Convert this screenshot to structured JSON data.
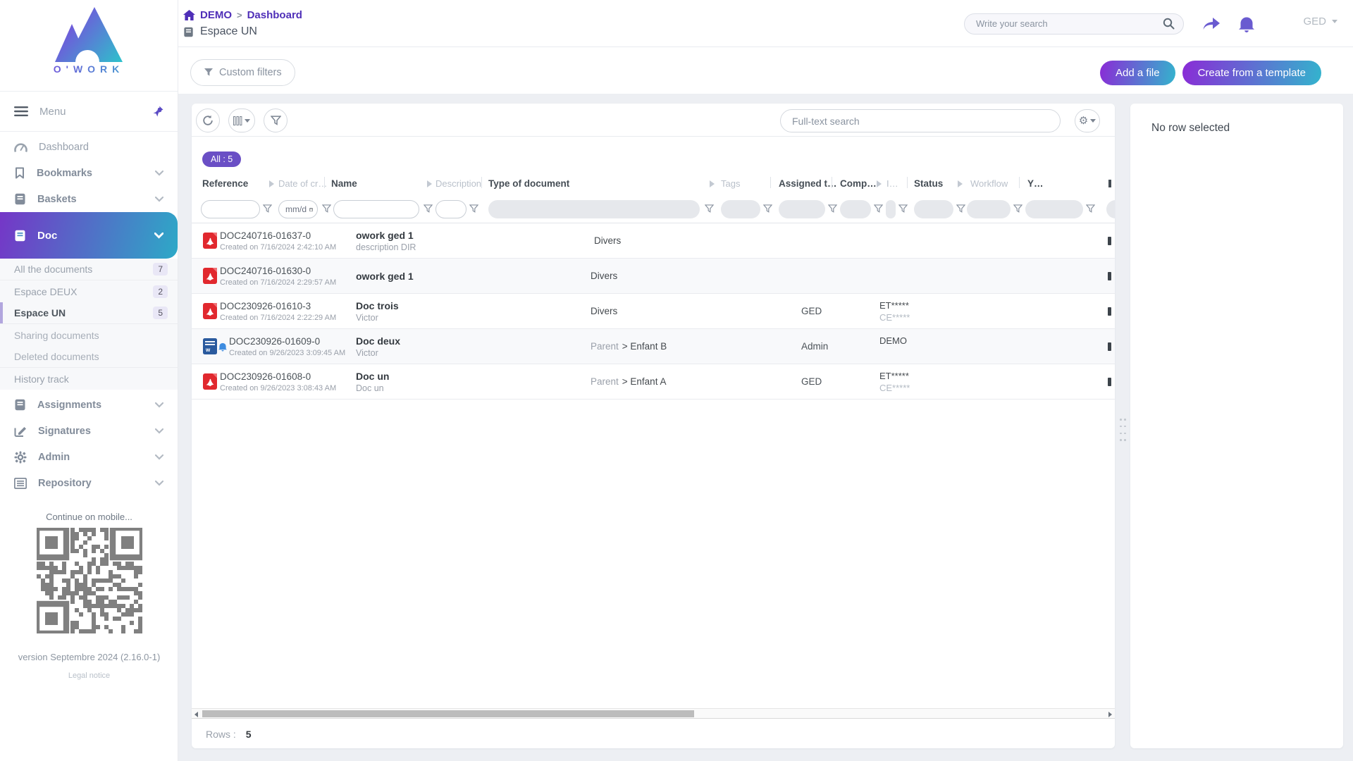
{
  "brand": {
    "name": "O'WORK"
  },
  "header": {
    "breadcrumb": {
      "root": "DEMO",
      "sep": ">",
      "current": "Dashboard"
    },
    "space_title": "Espace UN",
    "search_placeholder": "Write your search",
    "user_menu": "GED",
    "custom_filters": "Custom filters",
    "add_file": "Add a file",
    "create_template": "Create from a template"
  },
  "sidebar": {
    "menu_label": "Menu",
    "dashboard": "Dashboard",
    "bookmarks": "Bookmarks",
    "baskets": "Baskets",
    "doc": "Doc",
    "doc_submenu": [
      {
        "label": "All the documents",
        "badge": "7"
      },
      {
        "label": "Espace DEUX",
        "badge": "2"
      },
      {
        "label": "Espace UN",
        "badge": "5"
      },
      {
        "label": "Sharing documents",
        "badge": ""
      },
      {
        "label": "Deleted documents",
        "badge": ""
      },
      {
        "label": "History track",
        "badge": ""
      }
    ],
    "assignments": "Assignments",
    "signatures": "Signatures",
    "admin": "Admin",
    "repository": "Repository",
    "mobile_hint": "Continue on mobile...",
    "version": "version Septembre 2024 (2.16.0-1)",
    "legal": "Legal notice"
  },
  "toolbar": {
    "fulltext_placeholder": "Full-text search",
    "tab_all": "All : 5"
  },
  "table": {
    "columns": [
      {
        "label": "Reference"
      },
      {
        "label": "Date of cr…"
      },
      {
        "label": "Name"
      },
      {
        "label": "Description"
      },
      {
        "label": "Type of document"
      },
      {
        "label": "Tags"
      },
      {
        "label": "Assigned t…"
      },
      {
        "label": "Comp…"
      },
      {
        "label": "I…"
      },
      {
        "label": "Status"
      },
      {
        "label": "Workflow"
      },
      {
        "label": "Y…"
      }
    ],
    "date_filter_placeholder": "mm/d",
    "rows": [
      {
        "ref": "DOC240716-01637-0",
        "created": "Created on 7/16/2024 2:42:10 AM",
        "name": "owork ged 1",
        "name_sub": "description DIR",
        "type_parent": "",
        "type_name": "Divers",
        "assigned": "",
        "comp_top": "",
        "comp_sub": ""
      },
      {
        "ref": "DOC240716-01630-0",
        "created": "Created on 7/16/2024 2:29:57 AM",
        "name": "owork ged 1",
        "name_sub": "",
        "type_parent": "",
        "type_name": "Divers",
        "assigned": "",
        "comp_top": "",
        "comp_sub": ""
      },
      {
        "ref": "DOC230926-01610-3",
        "created": "Created on 7/16/2024 2:22:29 AM",
        "name": "Doc trois",
        "name_sub": "Victor",
        "type_parent": "",
        "type_name": "Divers",
        "assigned": "GED",
        "comp_top": "ET*****",
        "comp_sub": "CE*****"
      },
      {
        "ref": "DOC230926-01609-0",
        "created": "Created on 9/26/2023 3:09:45 AM",
        "name": "Doc deux",
        "name_sub": "Victor",
        "type_parent": "Parent",
        "type_name": "> Enfant B",
        "assigned": "Admin",
        "comp_top": "DEMO",
        "comp_sub": ""
      },
      {
        "ref": "DOC230926-01608-0",
        "created": "Created on 9/26/2023 3:08:43 AM",
        "name": "Doc un",
        "name_sub": "Doc un",
        "type_parent": "Parent",
        "type_name": "> Enfant A",
        "assigned": "GED",
        "comp_top": "ET*****",
        "comp_sub": "CE*****"
      }
    ],
    "rows_label": "Rows :",
    "rows_count": "5"
  },
  "right_panel": {
    "empty": "No row selected"
  }
}
